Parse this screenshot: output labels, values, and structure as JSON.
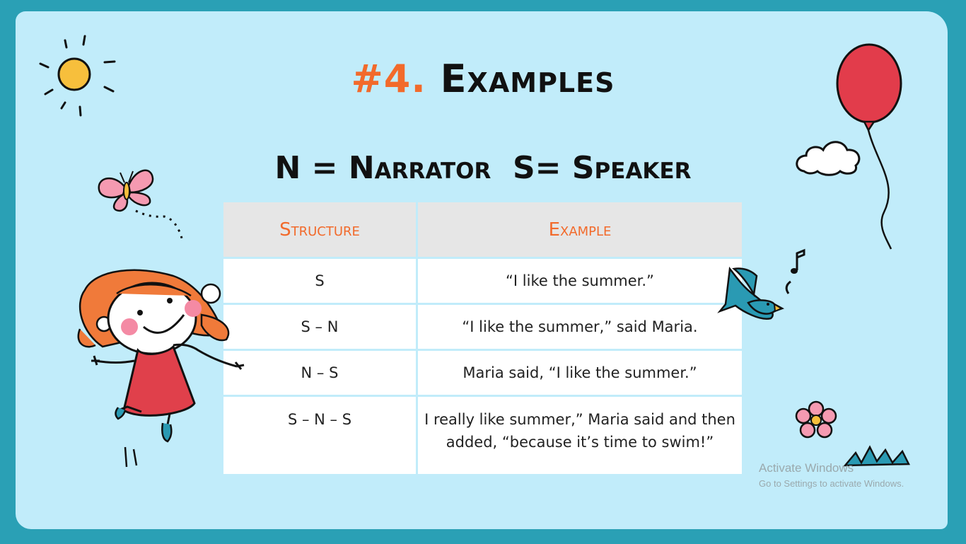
{
  "slide": {
    "title_number": "#4.",
    "title_text": "Examples",
    "subtitle": "N = Narrator  S= Speaker",
    "table": {
      "headers": [
        "Structure",
        "Example"
      ],
      "rows": [
        {
          "structure": "S",
          "example": "“I like the summer.”"
        },
        {
          "structure": "S – N",
          "example": "“I like the summer,” said Maria."
        },
        {
          "structure": "N – S",
          "example": "Maria said, “I like the summer.”"
        },
        {
          "structure": "S – N – S",
          "example_line1": "I really like summer,” Maria said and then",
          "example_line2": "added, “because it’s time to swim!”"
        }
      ]
    }
  },
  "watermark": {
    "line1": "Activate Windows",
    "line2": "Go to Settings to activate Windows."
  },
  "colors": {
    "frame": "#2aa0b5",
    "background": "#c1ecfa",
    "accent": "#f26a2b",
    "header_bg": "#e6e6e6"
  },
  "icons": [
    "sun-icon",
    "butterfly-icon",
    "girl-illustration",
    "balloon-icon",
    "cloud-icon",
    "bird-icon",
    "music-note-icon",
    "flower-icon",
    "grass-icon"
  ]
}
